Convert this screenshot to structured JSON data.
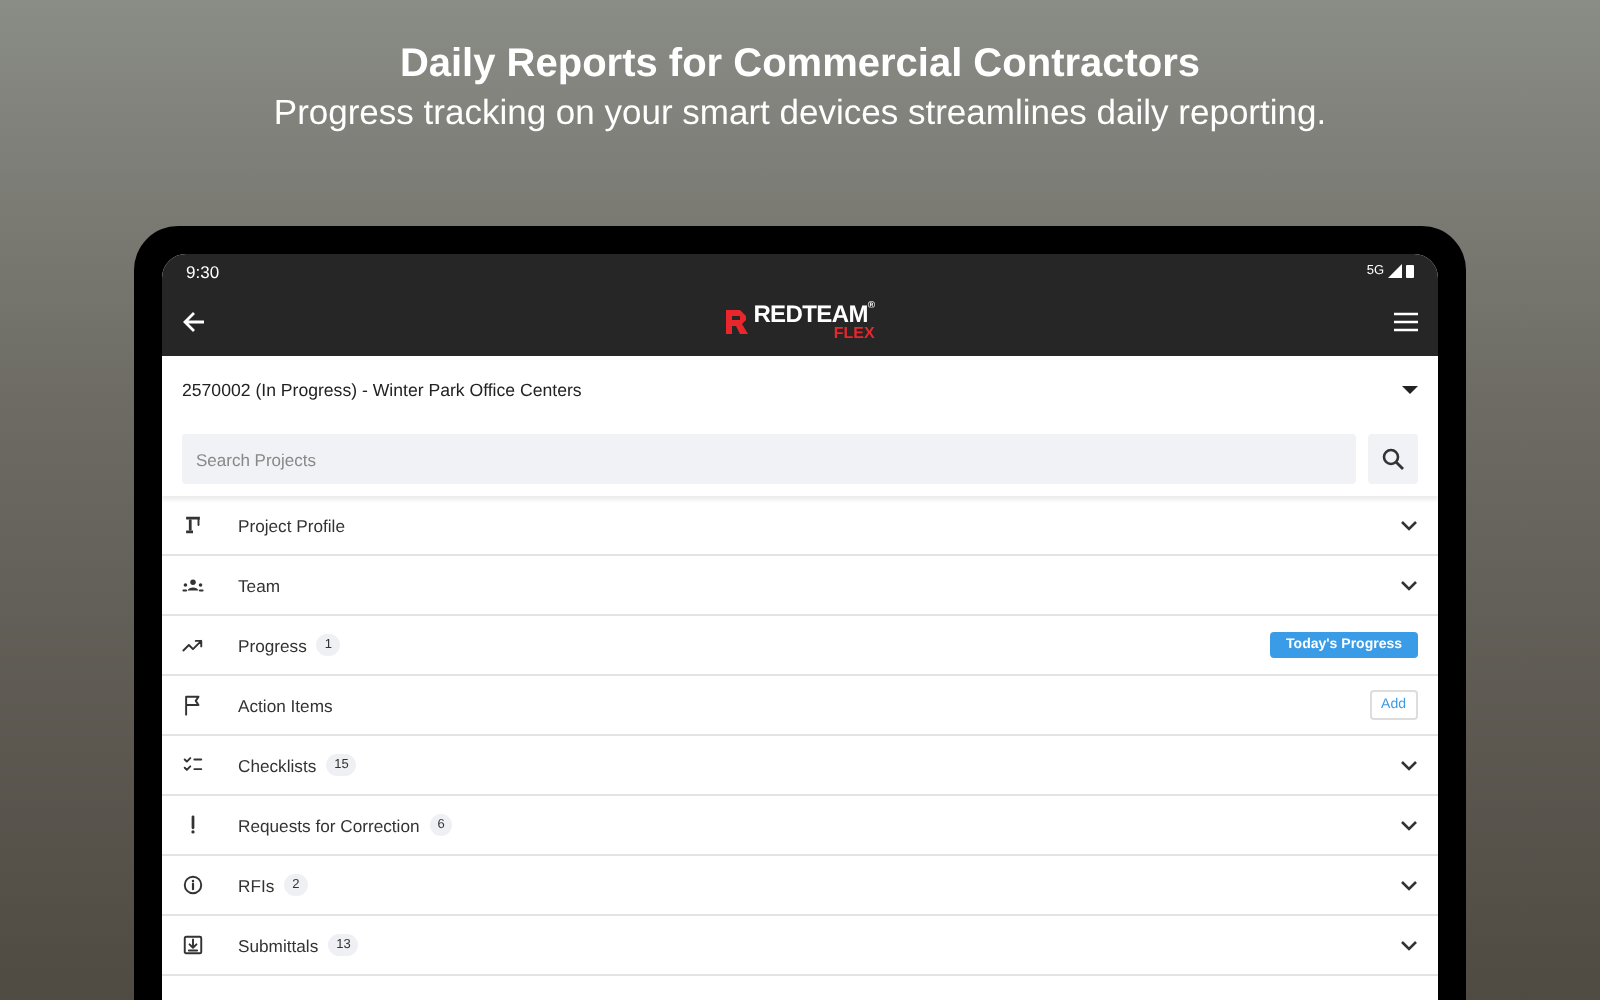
{
  "headline": {
    "title": "Daily Reports for Commercial Contractors",
    "subtitle": "Progress tracking on your smart devices streamlines daily reporting."
  },
  "status_bar": {
    "time": "9:30",
    "network": "5G"
  },
  "app_bar": {
    "logo": {
      "brand": "REDTEAM",
      "mark": "®",
      "product": "FLEX"
    }
  },
  "project_select": {
    "value": "2570002 (In Progress) - Winter Park Office Centers"
  },
  "search": {
    "placeholder": "Search Projects"
  },
  "sections": [
    {
      "label": "Project Profile",
      "kind": "expand"
    },
    {
      "label": "Team",
      "kind": "expand"
    },
    {
      "label": "Progress",
      "count": "1",
      "kind": "button",
      "action": "Today's Progress"
    },
    {
      "label": "Action Items",
      "kind": "add",
      "action": "Add"
    },
    {
      "label": "Checklists",
      "count": "15",
      "kind": "expand"
    },
    {
      "label": "Requests for Correction",
      "count": "6",
      "kind": "expand"
    },
    {
      "label": "RFIs",
      "count": "2",
      "kind": "expand"
    },
    {
      "label": "Submittals",
      "count": "13",
      "kind": "expand"
    }
  ]
}
